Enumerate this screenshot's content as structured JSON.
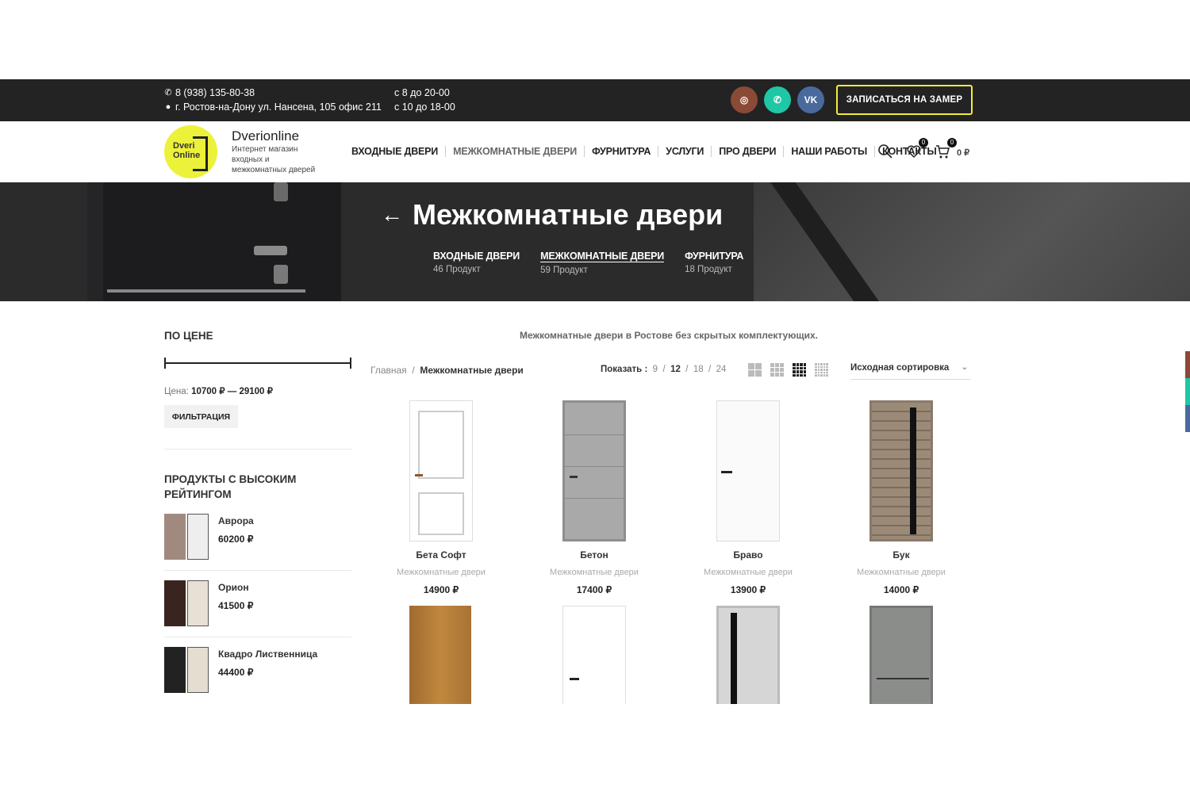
{
  "topbar": {
    "phone": "8 (938) 135-80-38",
    "address": "г. Ростов-на-Дону ул. Нансена, 105 офис 211",
    "hours_1": "с 8 до 20-00",
    "hours_2": "с 10 до 18-00",
    "socials": [
      {
        "name": "instagram-icon",
        "glyph": "◎"
      },
      {
        "name": "whatsapp-icon",
        "glyph": "✆"
      },
      {
        "name": "vk-icon",
        "glyph": "VK"
      }
    ],
    "cta_label": "ЗАПИСАТЬСЯ НА ЗАМЕР"
  },
  "logo": {
    "line1": "Dveri",
    "line2": "Online"
  },
  "brand": {
    "name": "Dverionline",
    "tagline": "Интернет магазин входных и межкомнатных дверей"
  },
  "nav": [
    "ВХОДНЫЕ ДВЕРИ",
    "МЕЖКОМНАТНЫЕ ДВЕРИ",
    "ФУРНИТУРА",
    "УСЛУГИ",
    "ПРО ДВЕРИ",
    "НАШИ РАБОТЫ",
    "КОНТАКТЫ"
  ],
  "header_icons": {
    "wishlist_count": "0",
    "cart_count": "0",
    "cart_sum": "0 ₽"
  },
  "hero": {
    "arrow": "←",
    "title": "Межкомнатные двери",
    "categories": [
      {
        "name": "ВХОДНЫЕ ДВЕРИ",
        "count": "46 Продукт"
      },
      {
        "name": "МЕЖКОМНАТНЫЕ ДВЕРИ",
        "count": "59 Продукт"
      },
      {
        "name": "ФУРНИТУРА",
        "count": "18 Продукт"
      }
    ]
  },
  "sidebar": {
    "price_heading": "ПО ЦЕНЕ",
    "price_label": "Цена:",
    "price_range": "10700 ₽ — 29100 ₽",
    "filter_button": "ФИЛЬТРАЦИЯ",
    "top_heading_1": "ПРОДУКТЫ С ВЫСОКИМ",
    "top_heading_2": "РЕЙТИНГОМ",
    "top_rated": [
      {
        "name": "Аврора",
        "price": "60200 ₽"
      },
      {
        "name": "Орион",
        "price": "41500 ₽"
      },
      {
        "name": "Квадро Лиственница",
        "price": "44400 ₽"
      }
    ]
  },
  "main": {
    "intro": "Межкомнатные двери в Ростове без скрытых комплектующих.",
    "breadcrumb_home": "Главная",
    "breadcrumb_sep": "/",
    "breadcrumb_current": "Межкомнатные двери",
    "show_label": "Показать :",
    "show_options": [
      "9",
      "12",
      "18",
      "24"
    ],
    "sort_label": "Исходная сортировка",
    "products": [
      {
        "name": "Бета Софт",
        "category": "Межкомнатные двери",
        "price": "14900 ₽"
      },
      {
        "name": "Бетон",
        "category": "Межкомнатные двери",
        "price": "17400 ₽"
      },
      {
        "name": "Браво",
        "category": "Межкомнатные двери",
        "price": "13900 ₽"
      },
      {
        "name": "Бук",
        "category": "Межкомнатные двери",
        "price": "14000 ₽"
      }
    ]
  }
}
